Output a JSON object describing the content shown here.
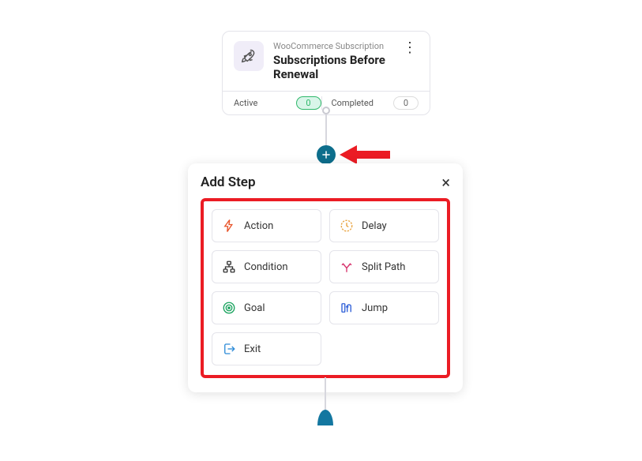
{
  "trigger": {
    "subtitle": "WooCommerce Subscription",
    "title": "Subscriptions Before Renewal",
    "stats": {
      "active_label": "Active",
      "active_value": "0",
      "completed_label": "Completed",
      "completed_value": "0"
    }
  },
  "popup": {
    "title": "Add Step",
    "steps": {
      "action": "Action",
      "delay": "Delay",
      "condition": "Condition",
      "split": "Split Path",
      "goal": "Goal",
      "jump": "Jump",
      "exit": "Exit"
    }
  },
  "icons": {
    "rocket": "rocket",
    "plus": "plus",
    "close": "×"
  },
  "colors": {
    "highlight": "#eb1c24",
    "add_btn": "#0d6e8c"
  }
}
